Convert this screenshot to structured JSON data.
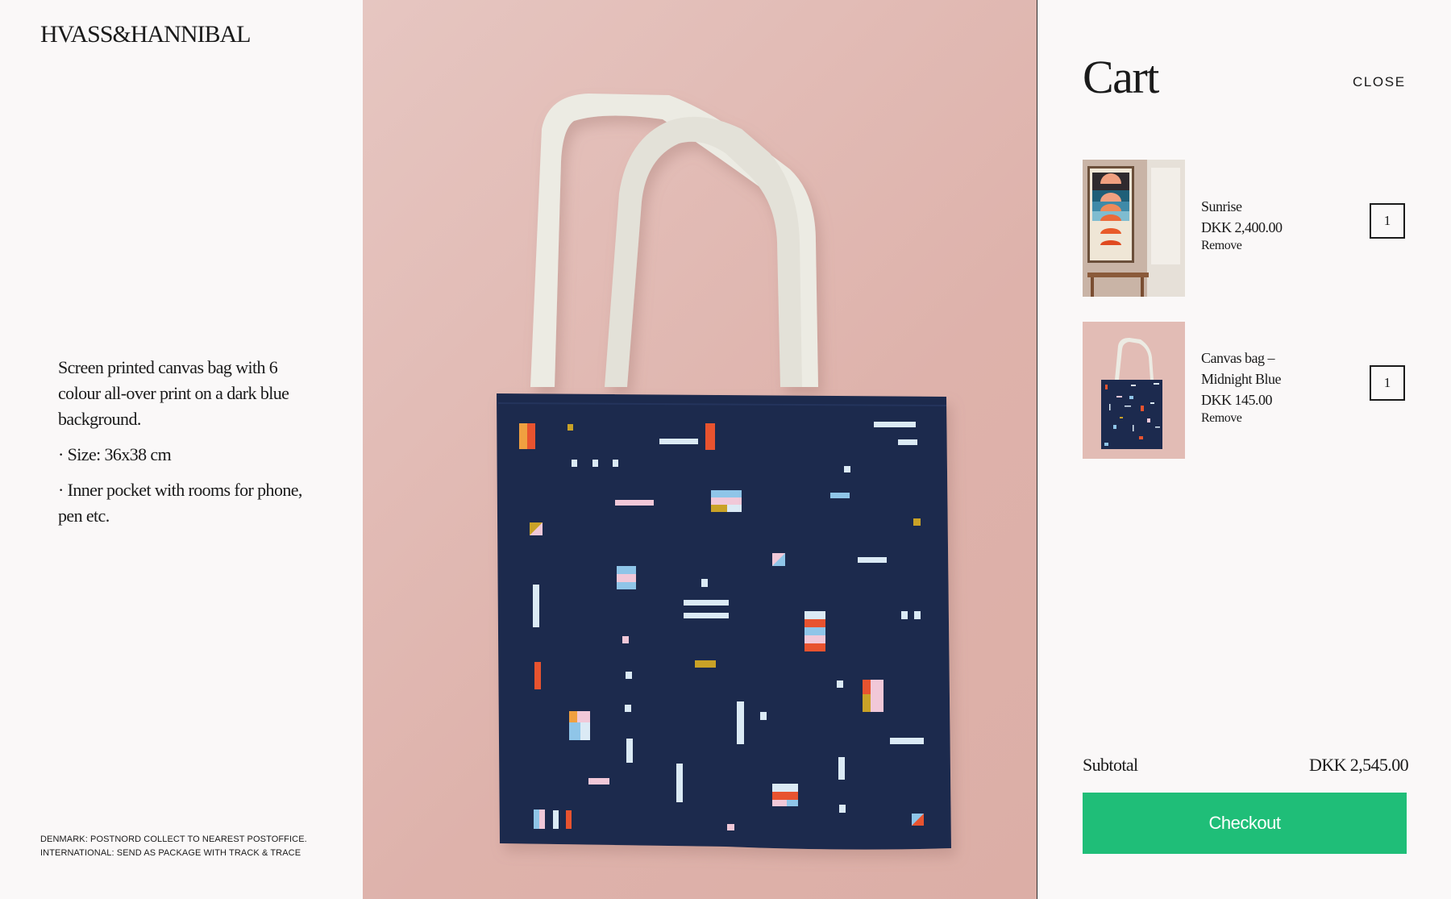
{
  "brand": {
    "logo_text": "HVASS&HANNIBAL"
  },
  "product": {
    "description": [
      "Screen printed canvas bag with 6 colour all-over print on a dark blue background.",
      "· Size: 36x38 cm",
      "· Inner pocket with rooms for phone, pen etc."
    ],
    "image_icon": "tote-bag-photo"
  },
  "shipping": {
    "line1": "DENMARK: POSTNORD COLLECT TO NEAREST POSTOFFICE.",
    "line2": "INTERNATIONAL: SEND AS PACKAGE WITH TRACK & TRACE"
  },
  "cart": {
    "title": "Cart",
    "close_label": "CLOSE",
    "items": [
      {
        "name": "Sunrise",
        "price": "DKK 2,400.00",
        "remove_label": "Remove",
        "quantity": "1"
      },
      {
        "name": "Canvas bag – Midnight Blue",
        "price": "DKK 145.00",
        "remove_label": "Remove",
        "quantity": "1"
      }
    ],
    "subtotal_label": "Subtotal",
    "subtotal_value": "DKK 2,545.00",
    "checkout_label": "Checkout"
  },
  "colors": {
    "checkout_green": "#1fbe78",
    "hero_pink": "#deb2ab",
    "bag_navy": "#1c2a4e",
    "strap_cream": "#ecebe3"
  }
}
